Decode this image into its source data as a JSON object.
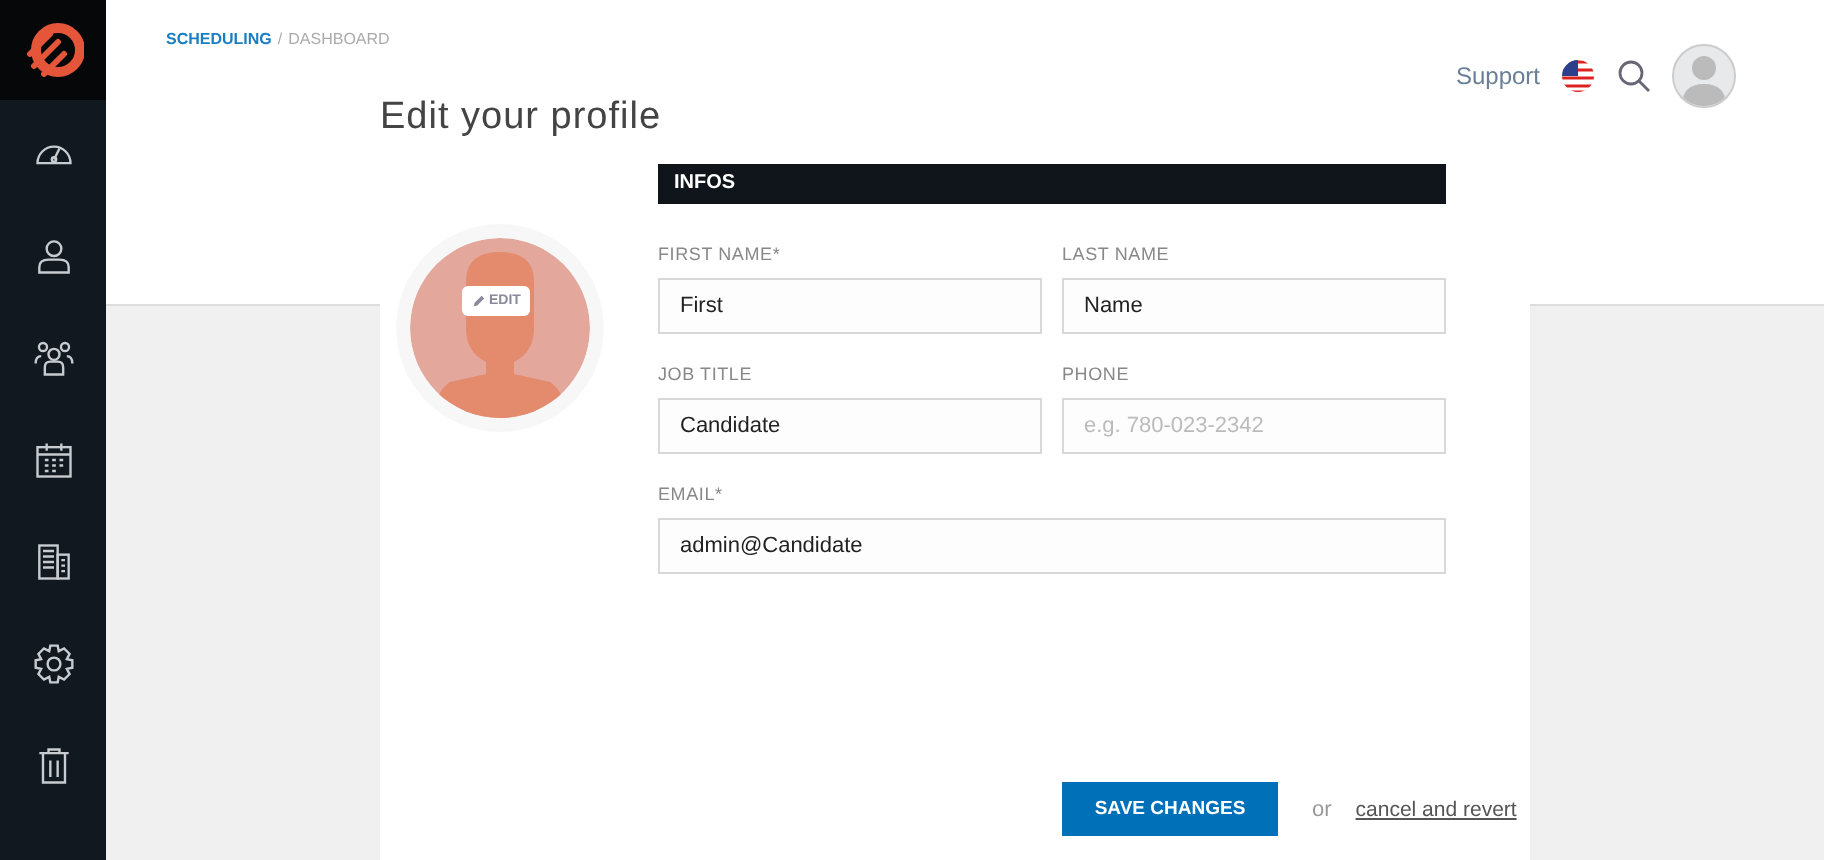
{
  "breadcrumb": [
    {
      "label": "SCHEDULING",
      "kind": "link"
    },
    {
      "label": "/",
      "kind": "separator"
    },
    {
      "label": "DASHBOARD",
      "kind": "current"
    }
  ],
  "header": {
    "support": "Support"
  },
  "profile": {
    "title": "Edit your profile",
    "avatar_button": "EDIT",
    "section": "INFOS",
    "fields": [
      {
        "label": "FIRST NAME*",
        "value": "First",
        "kind": "half"
      },
      {
        "label": "LAST NAME",
        "value": "Name",
        "kind": "half"
      },
      {
        "label": "JOB TITLE",
        "value": "Candidate",
        "kind": "half"
      },
      {
        "label": "PHONE",
        "placeholder": "e.g. 780-023-2342",
        "kind": "half"
      },
      {
        "label": "EMAIL*",
        "value": "admin@Candidate",
        "kind": "full"
      }
    ],
    "save": "SAVE CHANGES",
    "or": "or",
    "cancel": "cancel and revert"
  }
}
